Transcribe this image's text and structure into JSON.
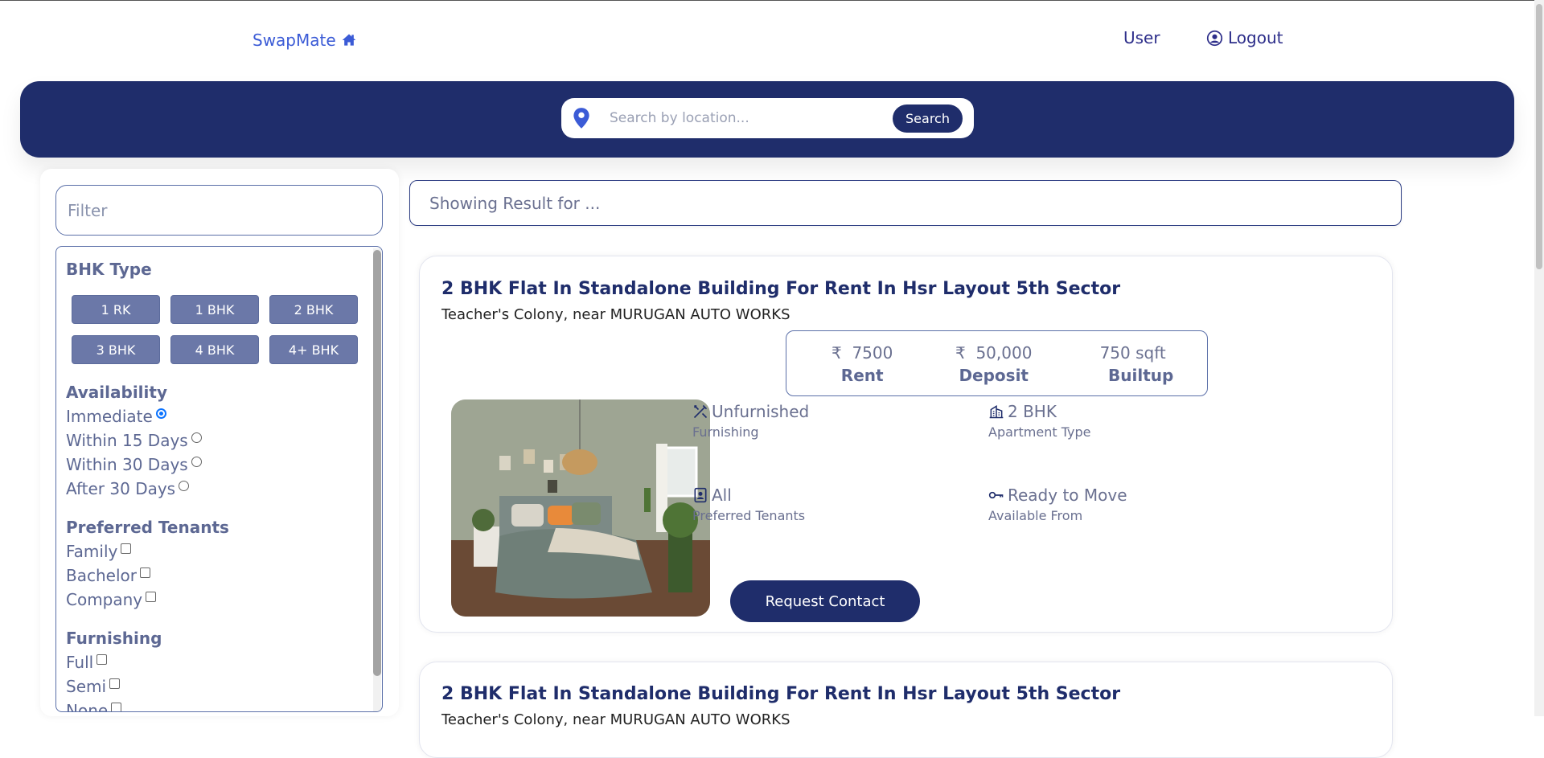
{
  "nav": {
    "brand": "SwapMate",
    "user": "User",
    "logout": "Logout"
  },
  "search": {
    "placeholder": "Search by location...",
    "button": "Search"
  },
  "filter": {
    "placeholder": "Filter",
    "bhk_title": "BHK Type",
    "bhk_options": [
      "1 RK",
      "1 BHK",
      "2 BHK",
      "3 BHK",
      "4 BHK",
      "4+ BHK"
    ],
    "availability_title": "Availability",
    "availability": [
      {
        "label": "Immediate",
        "selected": true
      },
      {
        "label": "Within 15 Days",
        "selected": false
      },
      {
        "label": "Within 30 Days",
        "selected": false
      },
      {
        "label": "After 30 Days",
        "selected": false
      }
    ],
    "tenants_title": "Preferred Tenants",
    "tenants": [
      "Family",
      "Bachelor",
      "Company"
    ],
    "furnishing_title": "Furnishing",
    "furnishing": [
      "Full",
      "Semi",
      "None"
    ]
  },
  "results": {
    "placeholder": "Showing Result for ..."
  },
  "listings": [
    {
      "title": "2 BHK Flat In Standalone Building For Rent In Hsr Layout 5th Sector",
      "subtitle": "Teacher's Colony, near MURUGAN AUTO WORKS",
      "rent": "7500",
      "rent_label": "Rent",
      "deposit": "50,000",
      "deposit_label": "Deposit",
      "builtup": "750 sqft",
      "builtup_label": "Builtup",
      "currency": "₹",
      "furnishing": "Unfurnished",
      "furnishing_label": "Furnishing",
      "apartment": "2 BHK",
      "apartment_label": "Apartment Type",
      "tenants": "All",
      "tenants_label": "Preferred Tenants",
      "available": "Ready to Move",
      "available_label": "Available From",
      "cta": "Request Contact"
    },
    {
      "title": "2 BHK Flat In Standalone Building For Rent In Hsr Layout 5th Sector",
      "subtitle": "Teacher's Colony, near MURUGAN AUTO WORKS"
    }
  ],
  "colors": {
    "primary": "#1f2d6b",
    "brand": "#3b5bd6",
    "chip": "#6b78a8",
    "muted": "#6a7090"
  }
}
